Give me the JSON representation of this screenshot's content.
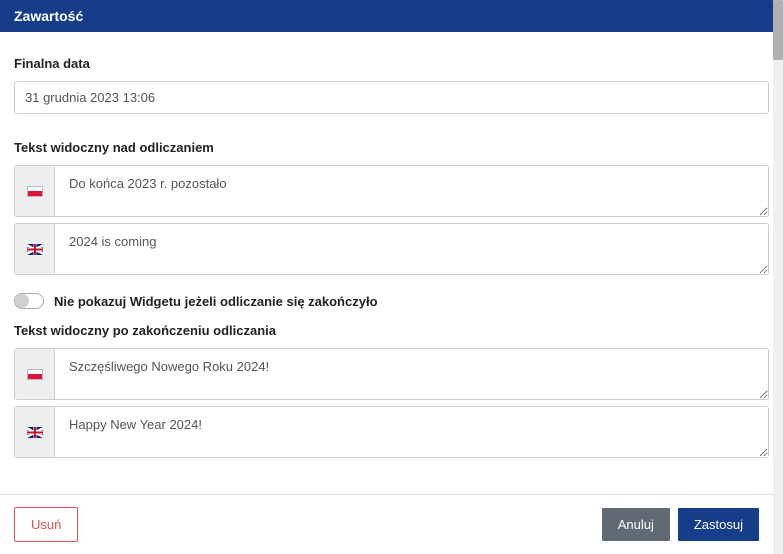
{
  "header": {
    "title": "Zawartość"
  },
  "sections": {
    "finalDate": {
      "label": "Finalna data",
      "value": "31 grudnia 2023 13:06"
    },
    "textAbove": {
      "label": "Tekst widoczny nad odliczaniem",
      "pl": "Do końca 2023 r. pozostało",
      "en": "2024 is coming"
    },
    "toggle": {
      "label": "Nie pokazuj Widgetu jeżeli odliczanie się zakończyło",
      "checked": false
    },
    "textAfter": {
      "label": "Tekst widoczny po zakończeniu odliczania",
      "pl": "Szczęśliwego Nowego Roku 2024!",
      "en": "Happy New Year 2024!"
    }
  },
  "footer": {
    "delete": "Usuń",
    "cancel": "Anuluj",
    "apply": "Zastosuj"
  }
}
